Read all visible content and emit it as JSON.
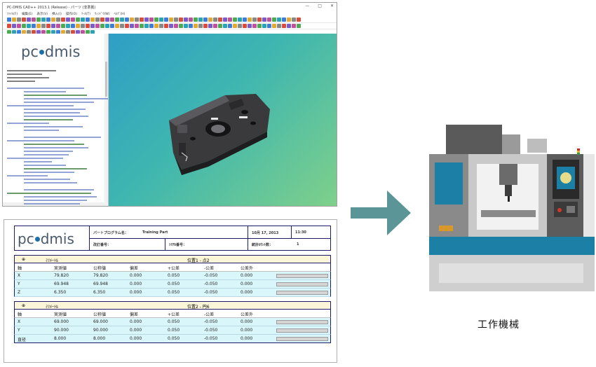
{
  "window": {
    "title": "PC-DMIS CAD++ 2013.1 (Release) - パーツ (非準拠)",
    "controls": [
      "—",
      "□",
      "✕"
    ],
    "menu": [
      "ﾌｧｲﾙ(F)",
      "編集(E)",
      "表示(V)",
      "挿入(I)",
      "操作(O)",
      "ﾂｰﾙ(T)",
      "ｳｨﾝﾄﾞｳ(W)",
      "ﾍﾙﾌﾟ(H)"
    ],
    "logo_left": "pc",
    "logo_right": "dmis"
  },
  "report": {
    "logo_left": "pc",
    "logo_right": "dmis",
    "part_program_label": "パートプログラム名：",
    "part_program_value": "Training Part",
    "date": "10月 17, 2013",
    "time": "11:30",
    "revision_label": "改訂番号：",
    "serial_label": "ｼﾘｱﾙ番号：",
    "stat_label": "統計ｶｳﾝﾄ数：",
    "stat_value": "1",
    "sections": [
      {
        "unit": "ﾐﾘﾒｰﾄﾙ",
        "title": "位置1 - 点2",
        "headers": [
          "軸",
          "実測値",
          "公称値",
          "偏差",
          "+公差",
          "-公差",
          "公差外"
        ],
        "rows": [
          [
            "X",
            "79.820",
            "79.820",
            "0.000",
            "0.050",
            "-0.050",
            "0.000"
          ],
          [
            "Y",
            "69.948",
            "69.948",
            "0.000",
            "0.050",
            "-0.050",
            "0.000"
          ],
          [
            "Z",
            "6.350",
            "6.350",
            "0.000",
            "0.050",
            "-0.050",
            "0.000"
          ]
        ]
      },
      {
        "unit": "ﾐﾘﾒｰﾄﾙ",
        "title": "位置2 - 円6",
        "headers": [
          "軸",
          "実測値",
          "公称値",
          "偏差",
          "+公差",
          "-公差",
          "公差外"
        ],
        "rows": [
          [
            "X",
            "69.000",
            "69.000",
            "0.000",
            "0.050",
            "-0.050",
            "0.000"
          ],
          [
            "Y",
            "90.000",
            "90.000",
            "0.000",
            "0.050",
            "-0.050",
            "0.000"
          ],
          [
            "直径",
            "8.000",
            "8.000",
            "0.000",
            "0.050",
            "-0.050",
            "0.000"
          ]
        ]
      }
    ]
  },
  "machine_caption": "工作機械",
  "colors": {
    "arrow": "#5b9597",
    "viewport_start": "#2f9ec6",
    "viewport_end": "#7fd08a",
    "report_border": "#1c1c6a",
    "row_highlight": "#d9f6fa",
    "machine_blue": "#1b7fa6"
  }
}
